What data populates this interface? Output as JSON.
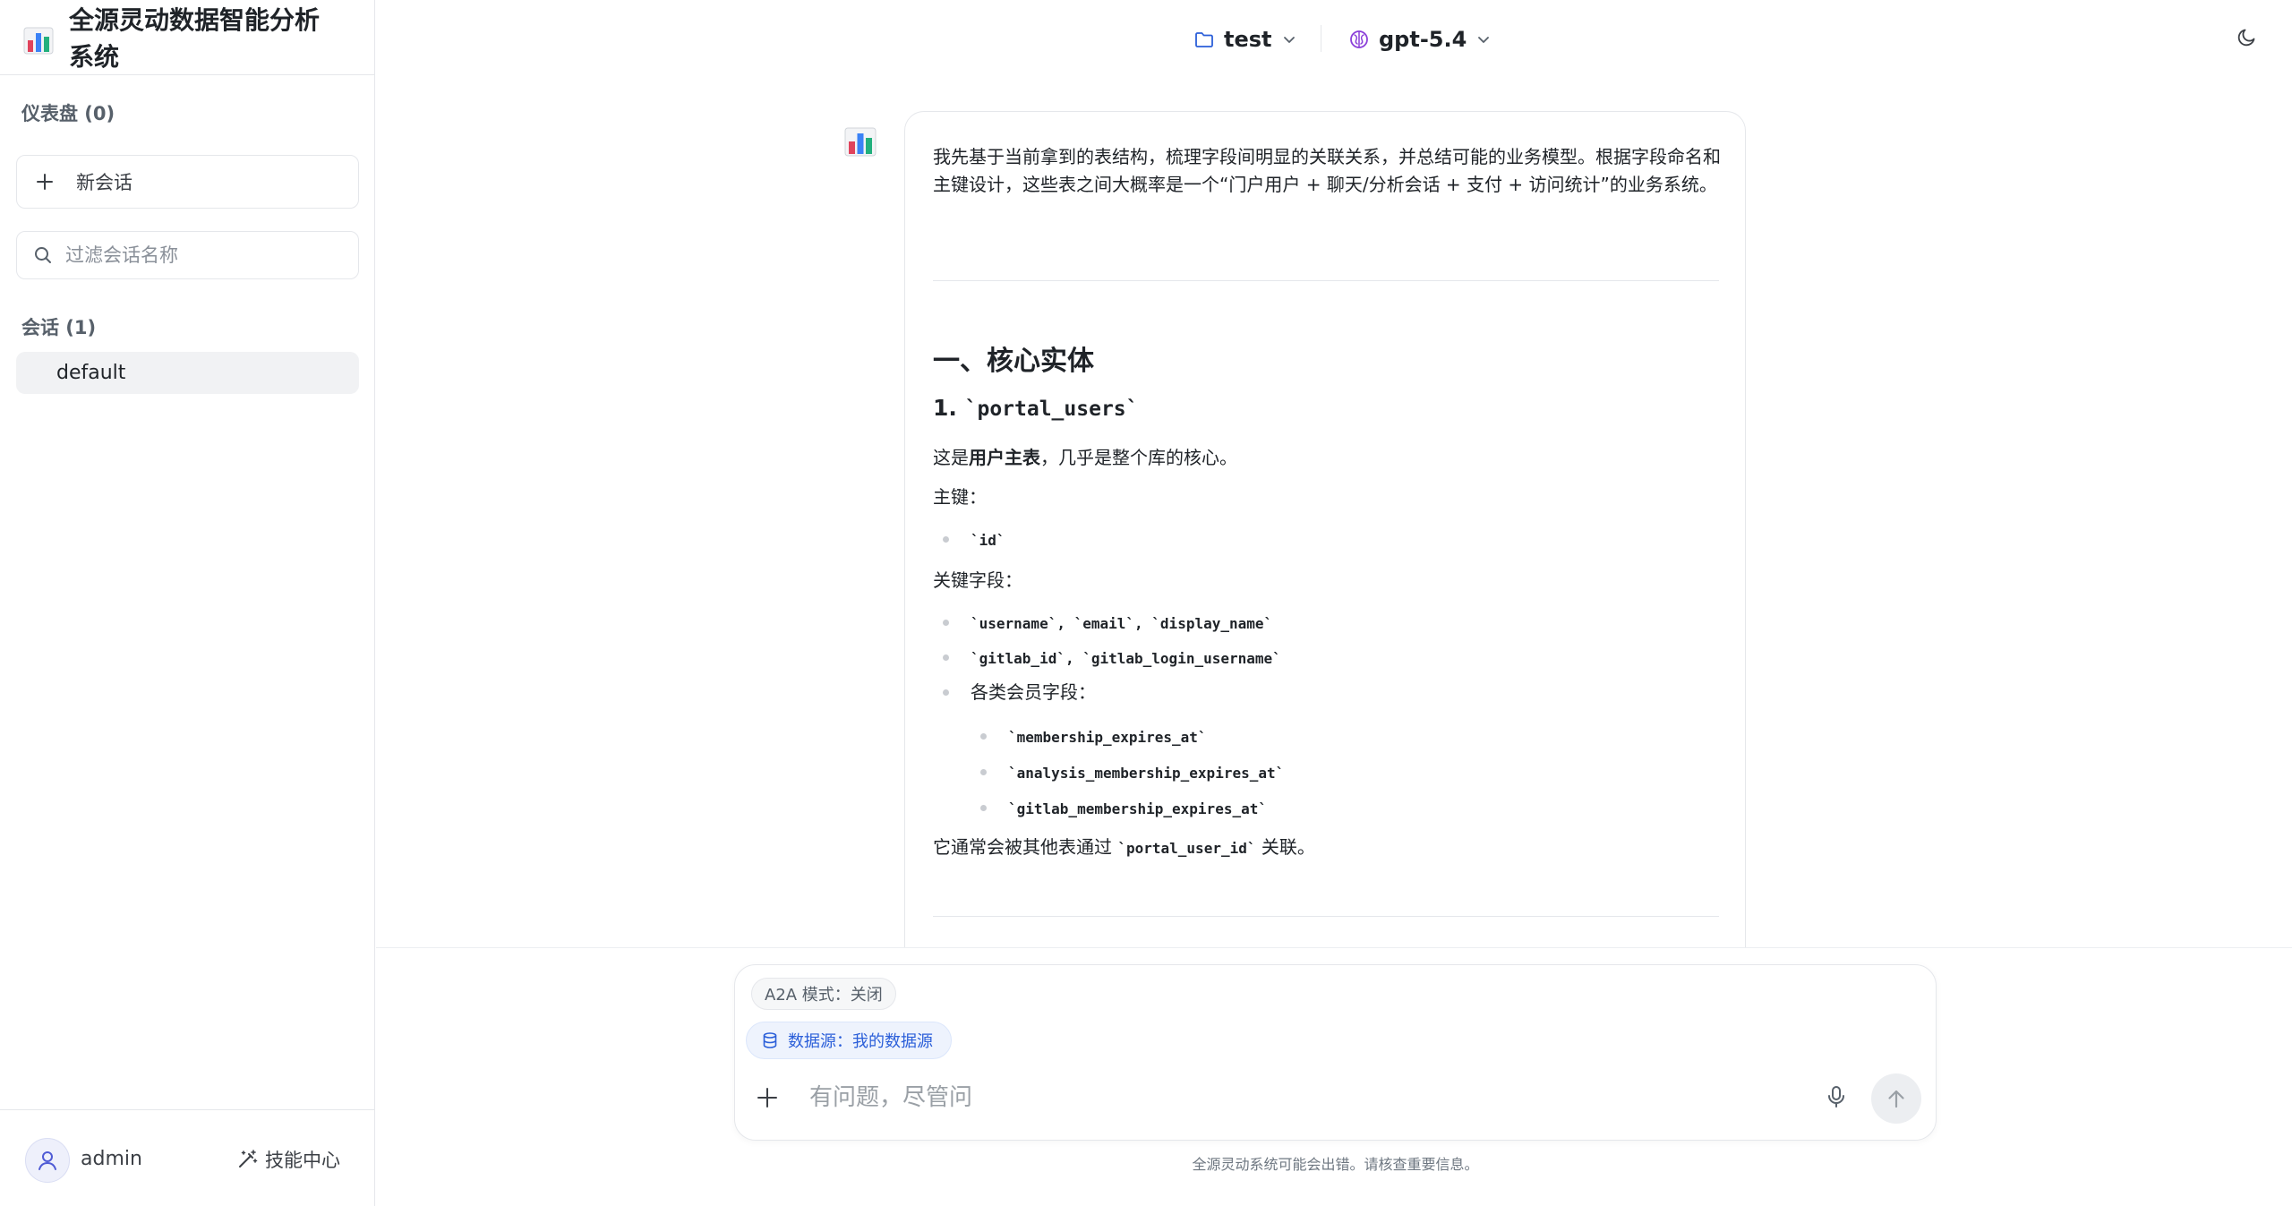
{
  "app": {
    "title": "全源灵动数据智能分析系统"
  },
  "sidebar": {
    "dashboards_label": "仪表盘 (0)",
    "new_chat_label": "新会话",
    "filter_placeholder": "过滤会话名称",
    "sessions_label": "会话 (1)",
    "sessions": [
      {
        "label": "default",
        "active": true
      }
    ],
    "user": {
      "name": "admin"
    },
    "skills_label": "技能中心"
  },
  "header": {
    "project": "test",
    "model": "gpt-5.4"
  },
  "message": {
    "intro": "我先基于当前拿到的表结构，梳理字段间明显的关联关系，并总结可能的业务模型。根据字段命名和主键设计，这些表之间大概率是一个“门户用户 + 聊天/分析会话 + 支付 + 访问统计”的业务系统。",
    "section1_title": "一、核心实体",
    "entity1_number": "1.",
    "entity1_name": "`portal_users`",
    "entity1_desc_prefix": "这是",
    "entity1_desc_bold": "用户主表",
    "entity1_desc_suffix": "，几乎是整个库的核心。",
    "pk_label": "主键：",
    "pk_items": [
      "`id`"
    ],
    "key_fields_label": "关键字段：",
    "key_field_1": "`username`, `email`, `display_name`",
    "key_field_2": "`gitlab_id`, `gitlab_login_username`",
    "key_field_3": "各类会员字段：",
    "membership_fields": [
      "`membership_expires_at`",
      "`analysis_membership_expires_at`",
      "`gitlab_membership_expires_at`"
    ],
    "relation_prefix": "它通常会被其他表通过",
    "relation_code": "`portal_user_id`",
    "relation_suffix": "关联。"
  },
  "composer": {
    "mode_chip": "A2A 模式：关闭",
    "datasource_chip": "数据源：我的数据源",
    "placeholder": "有问题，尽管问",
    "disclaimer": "全源灵动系统可能会出错。请核查重要信息。"
  },
  "colors": {
    "accent_blue": "#2b5fd9",
    "model_purple": "#8b3fd9",
    "border": "#e5e7eb"
  },
  "icons": {
    "brand": "bar-chart-logo-icon",
    "project": "folder-icon",
    "model": "brain-icon",
    "theme": "moon-icon",
    "new_chat": "plus-icon",
    "filter": "search-icon",
    "user": "user-icon",
    "skills": "magic-wand-icon",
    "datasource": "database-icon",
    "attach": "plus-icon",
    "voice": "microphone-icon",
    "send": "arrow-up-icon"
  }
}
